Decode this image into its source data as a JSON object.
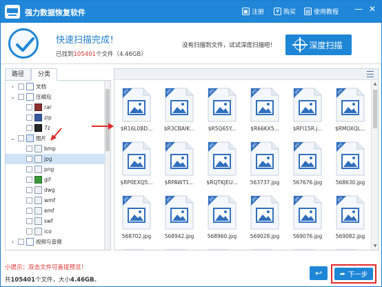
{
  "titlebar": {
    "app_title": "强力数据恢复软件",
    "register_label": "注册",
    "buy_label": "购买",
    "help_label": "使用教程",
    "minimize_glyph": "—",
    "close_glyph": "✕"
  },
  "status": {
    "done_title": "快速扫描完成！",
    "found_prefix": "已找到",
    "found_count": "105401",
    "found_suffix": "个文件（4.46GB）",
    "hint": "没有扫描到文件，试试深度扫描吧！",
    "deep_scan_label": "深度扫描"
  },
  "tabs": [
    {
      "label": "路径",
      "active": false
    },
    {
      "label": "分类",
      "active": true
    }
  ],
  "tree": [
    {
      "label": "文档",
      "expander": "›",
      "icon": "document-icon",
      "indent": 0
    },
    {
      "label": "压缩包",
      "expander": "⌄",
      "icon": "archive-icon",
      "indent": 0
    },
    {
      "label": "rar",
      "expander": "",
      "icon": "rar-icon",
      "indent": 1
    },
    {
      "label": "zip",
      "expander": "",
      "icon": "zip-icon",
      "indent": 1
    },
    {
      "label": "7z",
      "expander": "",
      "icon": "7z-icon",
      "indent": 1
    },
    {
      "label": "图片",
      "expander": "⌄",
      "icon": "image-folder-icon",
      "indent": 0
    },
    {
      "label": "bmp",
      "expander": "",
      "icon": "bmp-icon",
      "indent": 1
    },
    {
      "label": "jpg",
      "expander": "",
      "icon": "jpg-icon",
      "indent": 1,
      "selected": true
    },
    {
      "label": "png",
      "expander": "",
      "icon": "png-icon",
      "indent": 1
    },
    {
      "label": "gif",
      "expander": "",
      "icon": "gif-icon",
      "indent": 1
    },
    {
      "label": "dwg",
      "expander": "",
      "icon": "dwg-icon",
      "indent": 1
    },
    {
      "label": "wmf",
      "expander": "",
      "icon": "wmf-icon",
      "indent": 1
    },
    {
      "label": "emf",
      "expander": "",
      "icon": "emf-icon",
      "indent": 1
    },
    {
      "label": "swf",
      "expander": "",
      "icon": "swf-icon",
      "indent": 1
    },
    {
      "label": "ico",
      "expander": "",
      "icon": "ico-icon",
      "indent": 1
    },
    {
      "label": "视频与音频",
      "expander": "›",
      "icon": "media-icon",
      "indent": 0
    }
  ],
  "files": [
    "$R16L0BD...",
    "$R3CBAIK...",
    "$R5Q65Y...",
    "$R66KX5...",
    "$RFI15R.j...",
    "$RMOXQL...",
    "$RP0EXQ5...",
    "$RPAWT1...",
    "$RQTKJEU...",
    "563737.jpg",
    "567676.jpg",
    "568630.jpg",
    "568702.jpg",
    "568942.jpg",
    "568960.jpg",
    "569028.jpg",
    "569076.jpg",
    "569082.jpg",
    "",
    "",
    "",
    "",
    "",
    ""
  ],
  "footer": {
    "tip": "小提示：双击文件可直接预览！",
    "summary_prefix": "共",
    "summary_count": "105401",
    "summary_mid": "个文件，大小",
    "summary_size": "4.46GB",
    "summary_end": "。",
    "back_glyph": "↩",
    "next_label": "下一步"
  },
  "colors": {
    "accent": "#1e86d6",
    "highlight_red": "#e02a2a"
  }
}
